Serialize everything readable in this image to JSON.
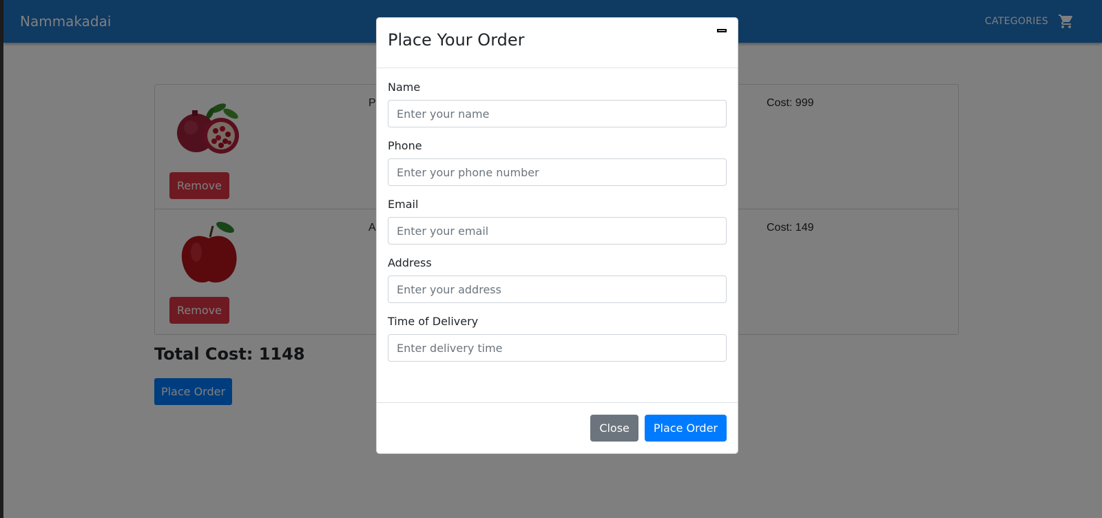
{
  "appbar": {
    "brand": "Nammakadai",
    "categories_label": "CATEGORIES",
    "cart_icon": "shopping-cart-icon"
  },
  "cart": {
    "items": [
      {
        "name": "Po",
        "cost_label": "Cost: 999",
        "image": "pomegranate-image",
        "remove_label": "Remove"
      },
      {
        "name": "A",
        "cost_label": "Cost: 149",
        "image": "apple-image",
        "remove_label": "Remove"
      }
    ],
    "total_label": "Total Cost: 1148",
    "place_order_label": "Place Order"
  },
  "modal": {
    "title": "Place Your Order",
    "close_icon": "close-icon",
    "fields": [
      {
        "label": "Name",
        "placeholder": "Enter your name",
        "value": ""
      },
      {
        "label": "Phone",
        "placeholder": "Enter your phone number",
        "value": ""
      },
      {
        "label": "Email",
        "placeholder": "Enter your email",
        "value": ""
      },
      {
        "label": "Address",
        "placeholder": "Enter your address",
        "value": ""
      },
      {
        "label": "Time of Delivery",
        "placeholder": "Enter delivery time",
        "value": ""
      }
    ],
    "close_label": "Close",
    "place_order_label": "Place Order"
  },
  "colors": {
    "appbar": "#1f74c4",
    "danger": "#dc3545",
    "primary": "#007bff",
    "secondary": "#6c757d"
  }
}
